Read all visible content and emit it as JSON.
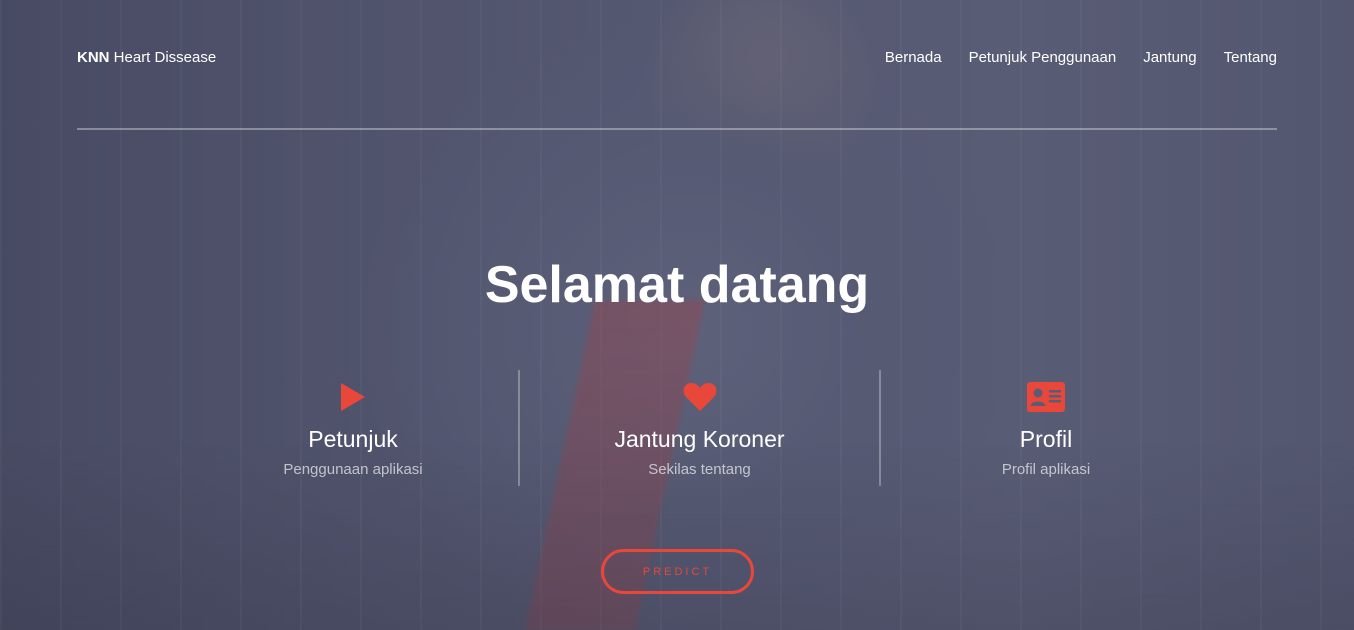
{
  "brand": {
    "bold": "KNN",
    "rest": "Heart Dissease"
  },
  "nav": [
    "Bernada",
    "Petunjuk Penggunaan",
    "Jantung",
    "Tentang"
  ],
  "hero": {
    "title": "Selamat datang"
  },
  "features": [
    {
      "icon": "play-icon",
      "title": "Petunjuk",
      "subtitle": "Penggunaan aplikasi"
    },
    {
      "icon": "heart-icon",
      "title": "Jantung Koroner",
      "subtitle": "Sekilas tentang"
    },
    {
      "icon": "id-card-icon",
      "title": "Profil",
      "subtitle": "Profil aplikasi"
    }
  ],
  "predict_label": "PREDICT",
  "colors": {
    "accent": "#e8473a",
    "overlay": "#464862"
  }
}
